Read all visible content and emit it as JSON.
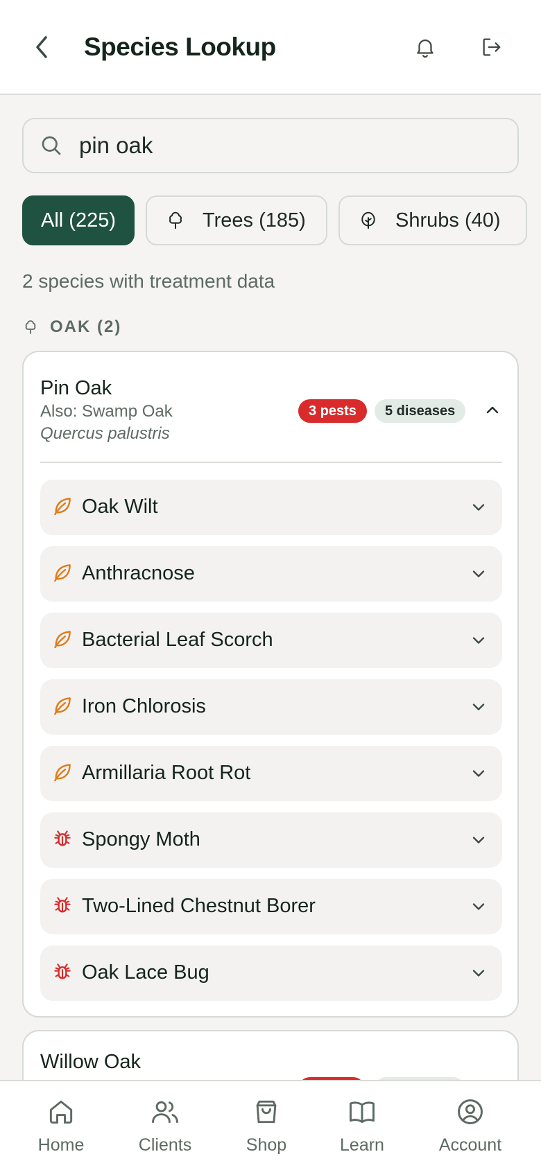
{
  "header": {
    "title": "Species Lookup",
    "back_icon": "chevron-left-icon",
    "bell_icon": "bell-icon",
    "logout_icon": "logout-icon"
  },
  "search": {
    "value": "pin oak",
    "icon": "search-icon"
  },
  "filters": [
    {
      "label": "All (225)",
      "active": true
    },
    {
      "label": "Trees (185)",
      "icon": "tree-icon",
      "active": false
    },
    {
      "label": "Shrubs (40)",
      "icon": "shrub-icon",
      "active": false
    }
  ],
  "summary": "2 species with treatment data",
  "group": {
    "label": "OAK (2)",
    "icon": "tree-icon"
  },
  "species": [
    {
      "name": "Pin Oak",
      "also": "Also: Swamp Oak",
      "scientific": "Quercus palustris",
      "pests_badge": "3 pests",
      "diseases_badge": "5 diseases",
      "expanded": true,
      "issues": [
        {
          "label": "Oak Wilt",
          "kind": "disease",
          "icon": "leaf-icon"
        },
        {
          "label": "Anthracnose",
          "kind": "disease",
          "icon": "leaf-icon"
        },
        {
          "label": "Bacterial Leaf Scorch",
          "kind": "disease",
          "icon": "leaf-icon"
        },
        {
          "label": "Iron Chlorosis",
          "kind": "disease",
          "icon": "leaf-icon"
        },
        {
          "label": "Armillaria Root Rot",
          "kind": "disease",
          "icon": "leaf-icon"
        },
        {
          "label": "Spongy Moth",
          "kind": "pest",
          "icon": "bug-icon"
        },
        {
          "label": "Two-Lined Chestnut Borer",
          "kind": "pest",
          "icon": "bug-icon"
        },
        {
          "label": "Oak Lace Bug",
          "kind": "pest",
          "icon": "bug-icon"
        }
      ]
    },
    {
      "name": "Willow Oak"
    }
  ],
  "tabs": [
    {
      "label": "Home",
      "icon": "home-icon"
    },
    {
      "label": "Clients",
      "icon": "users-icon"
    },
    {
      "label": "Shop",
      "icon": "shopping-bag-icon"
    },
    {
      "label": "Learn",
      "icon": "book-icon"
    },
    {
      "label": "Account",
      "icon": "account-circle-icon"
    }
  ],
  "colors": {
    "primary": "#1f5240",
    "pest": "#d92b2b",
    "disease": "#e07b1a",
    "background": "#f5f4f2"
  }
}
